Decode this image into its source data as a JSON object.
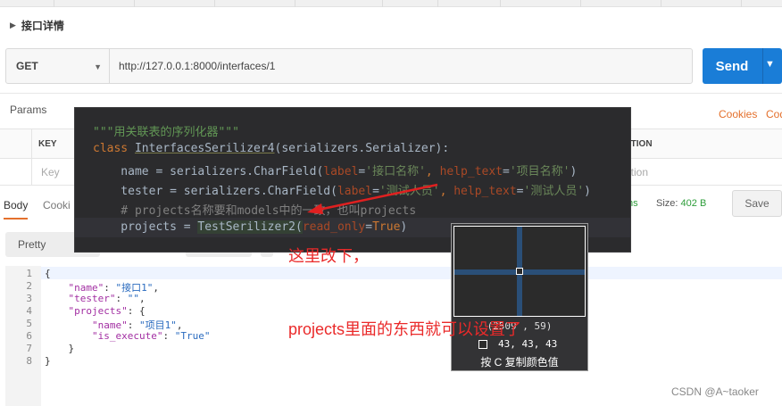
{
  "header": {
    "title": "接口详情"
  },
  "request": {
    "method": "GET",
    "url": "http://127.0.0.1:8000/interfaces/1",
    "send_label": "Send"
  },
  "params": {
    "tab_label": "Params",
    "cookies_label": "Cookies",
    "code_label": "Cod",
    "key_header": "KEY",
    "description_header": "PTION",
    "key_placeholder": "Key",
    "description_placeholder": "ption"
  },
  "response": {
    "body_tab": "Body",
    "cookies_tab": "Cooki",
    "time_text": "ms",
    "size_label": "Size:",
    "size_value": "402 B",
    "save_label": "Save",
    "view_mode": "Pretty",
    "line_numbers": [
      "1",
      "2",
      "3",
      "4",
      "5",
      "6",
      "7",
      "8"
    ]
  },
  "overlay_code": {
    "docstring": "\"\"\"用关联表的序列化器\"\"\"",
    "class_kw": "class ",
    "class_name": "InterfacesSerilizer4",
    "class_rest": "(serializers.Serializer):",
    "name_prefix": "    name = serializers.CharField(",
    "label_kw": "label",
    "name_label_val": "'接口名称'",
    "help_kw": "help_text",
    "name_help_val": "'项目名称'",
    "tester_prefix": "    tester = serializers.CharField(",
    "tester_label_val": "'测试人员'",
    "tester_help_val": "'测试人员'",
    "comment": "    # projects名称要和models中的一致，也叫projects",
    "projects_prefix": "    projects = ",
    "projects_call": "TestSerilizer2(",
    "read_only_kw": "read_only",
    "true_kw": "True",
    "projects_end": ")"
  },
  "annotations": {
    "note1": "这里改下，",
    "note2": "projects里面的东西就可以设置了"
  },
  "color_picker": {
    "coords": "(2509 , 59)",
    "rgb": "43,  43,  43",
    "hint": "按 C 复制颜色值"
  },
  "watermark": "CSDN @A~taoker",
  "colors": {
    "accent_orange": "#e4702c",
    "send_blue": "#1a7dd7",
    "annotation_red": "#ea2a2a"
  }
}
